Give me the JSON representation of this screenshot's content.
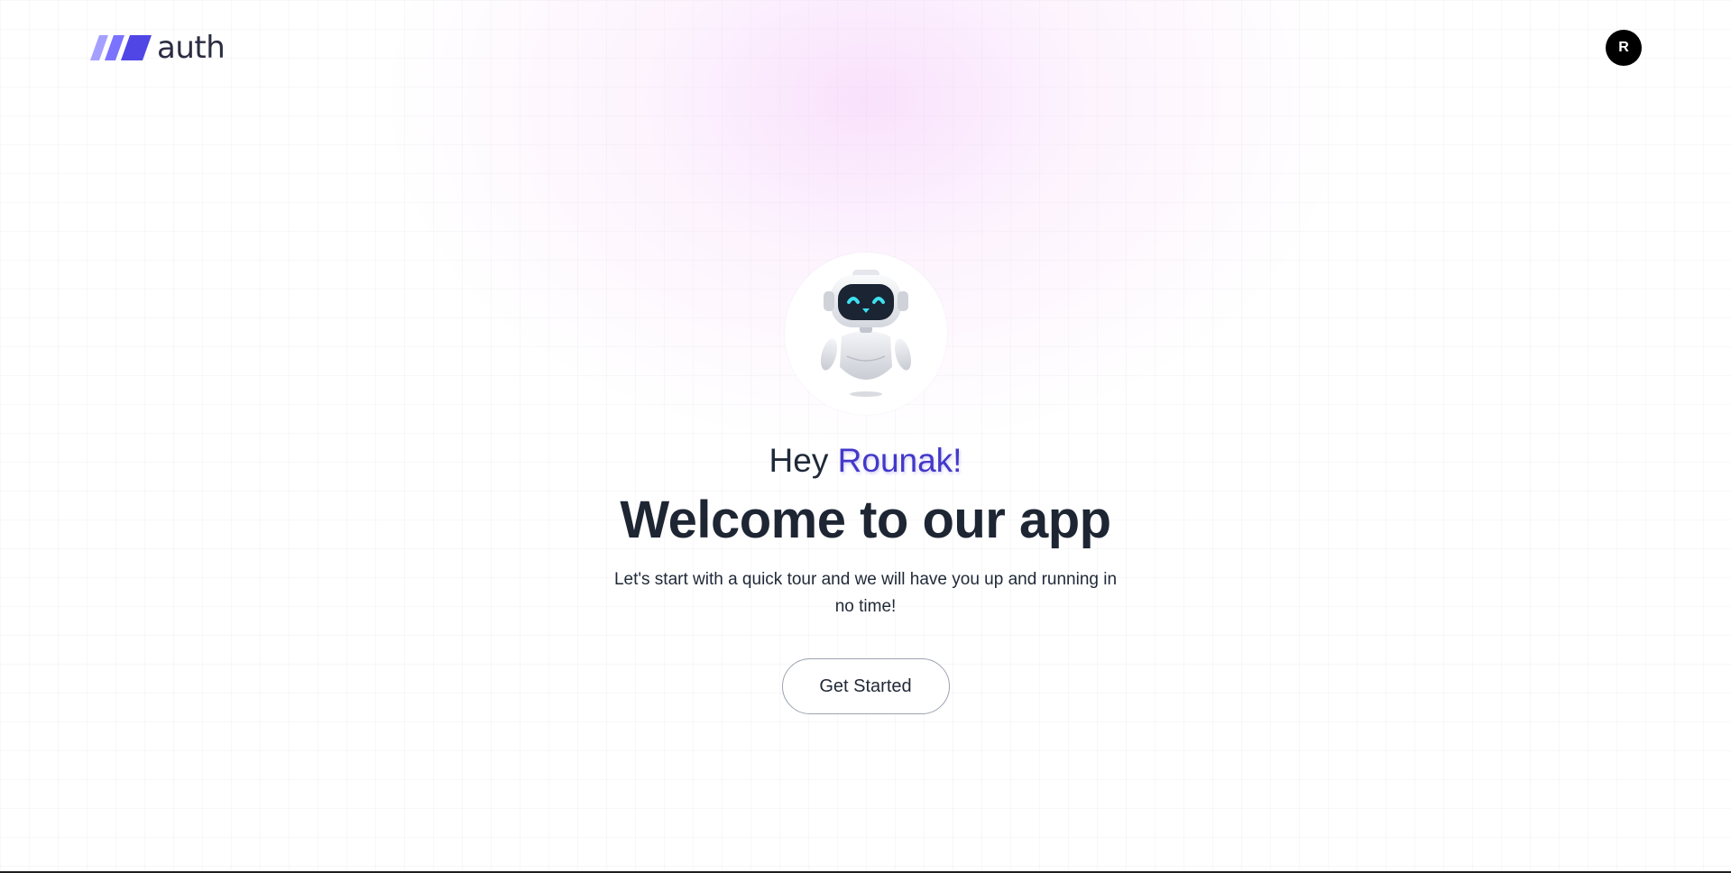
{
  "header": {
    "logo_text": "auth",
    "logo_colors": [
      "#a5a0ff",
      "#7b73ff",
      "#4f46e5"
    ],
    "avatar_initial": "R"
  },
  "hero": {
    "greeting_prefix": "Hey",
    "greeting_name": "Rounak!",
    "title": "Welcome to our app",
    "subtitle": "Let's start with a quick tour and we will have you up and running in no time!",
    "cta_label": "Get Started",
    "accent_color": "#4338ca"
  }
}
